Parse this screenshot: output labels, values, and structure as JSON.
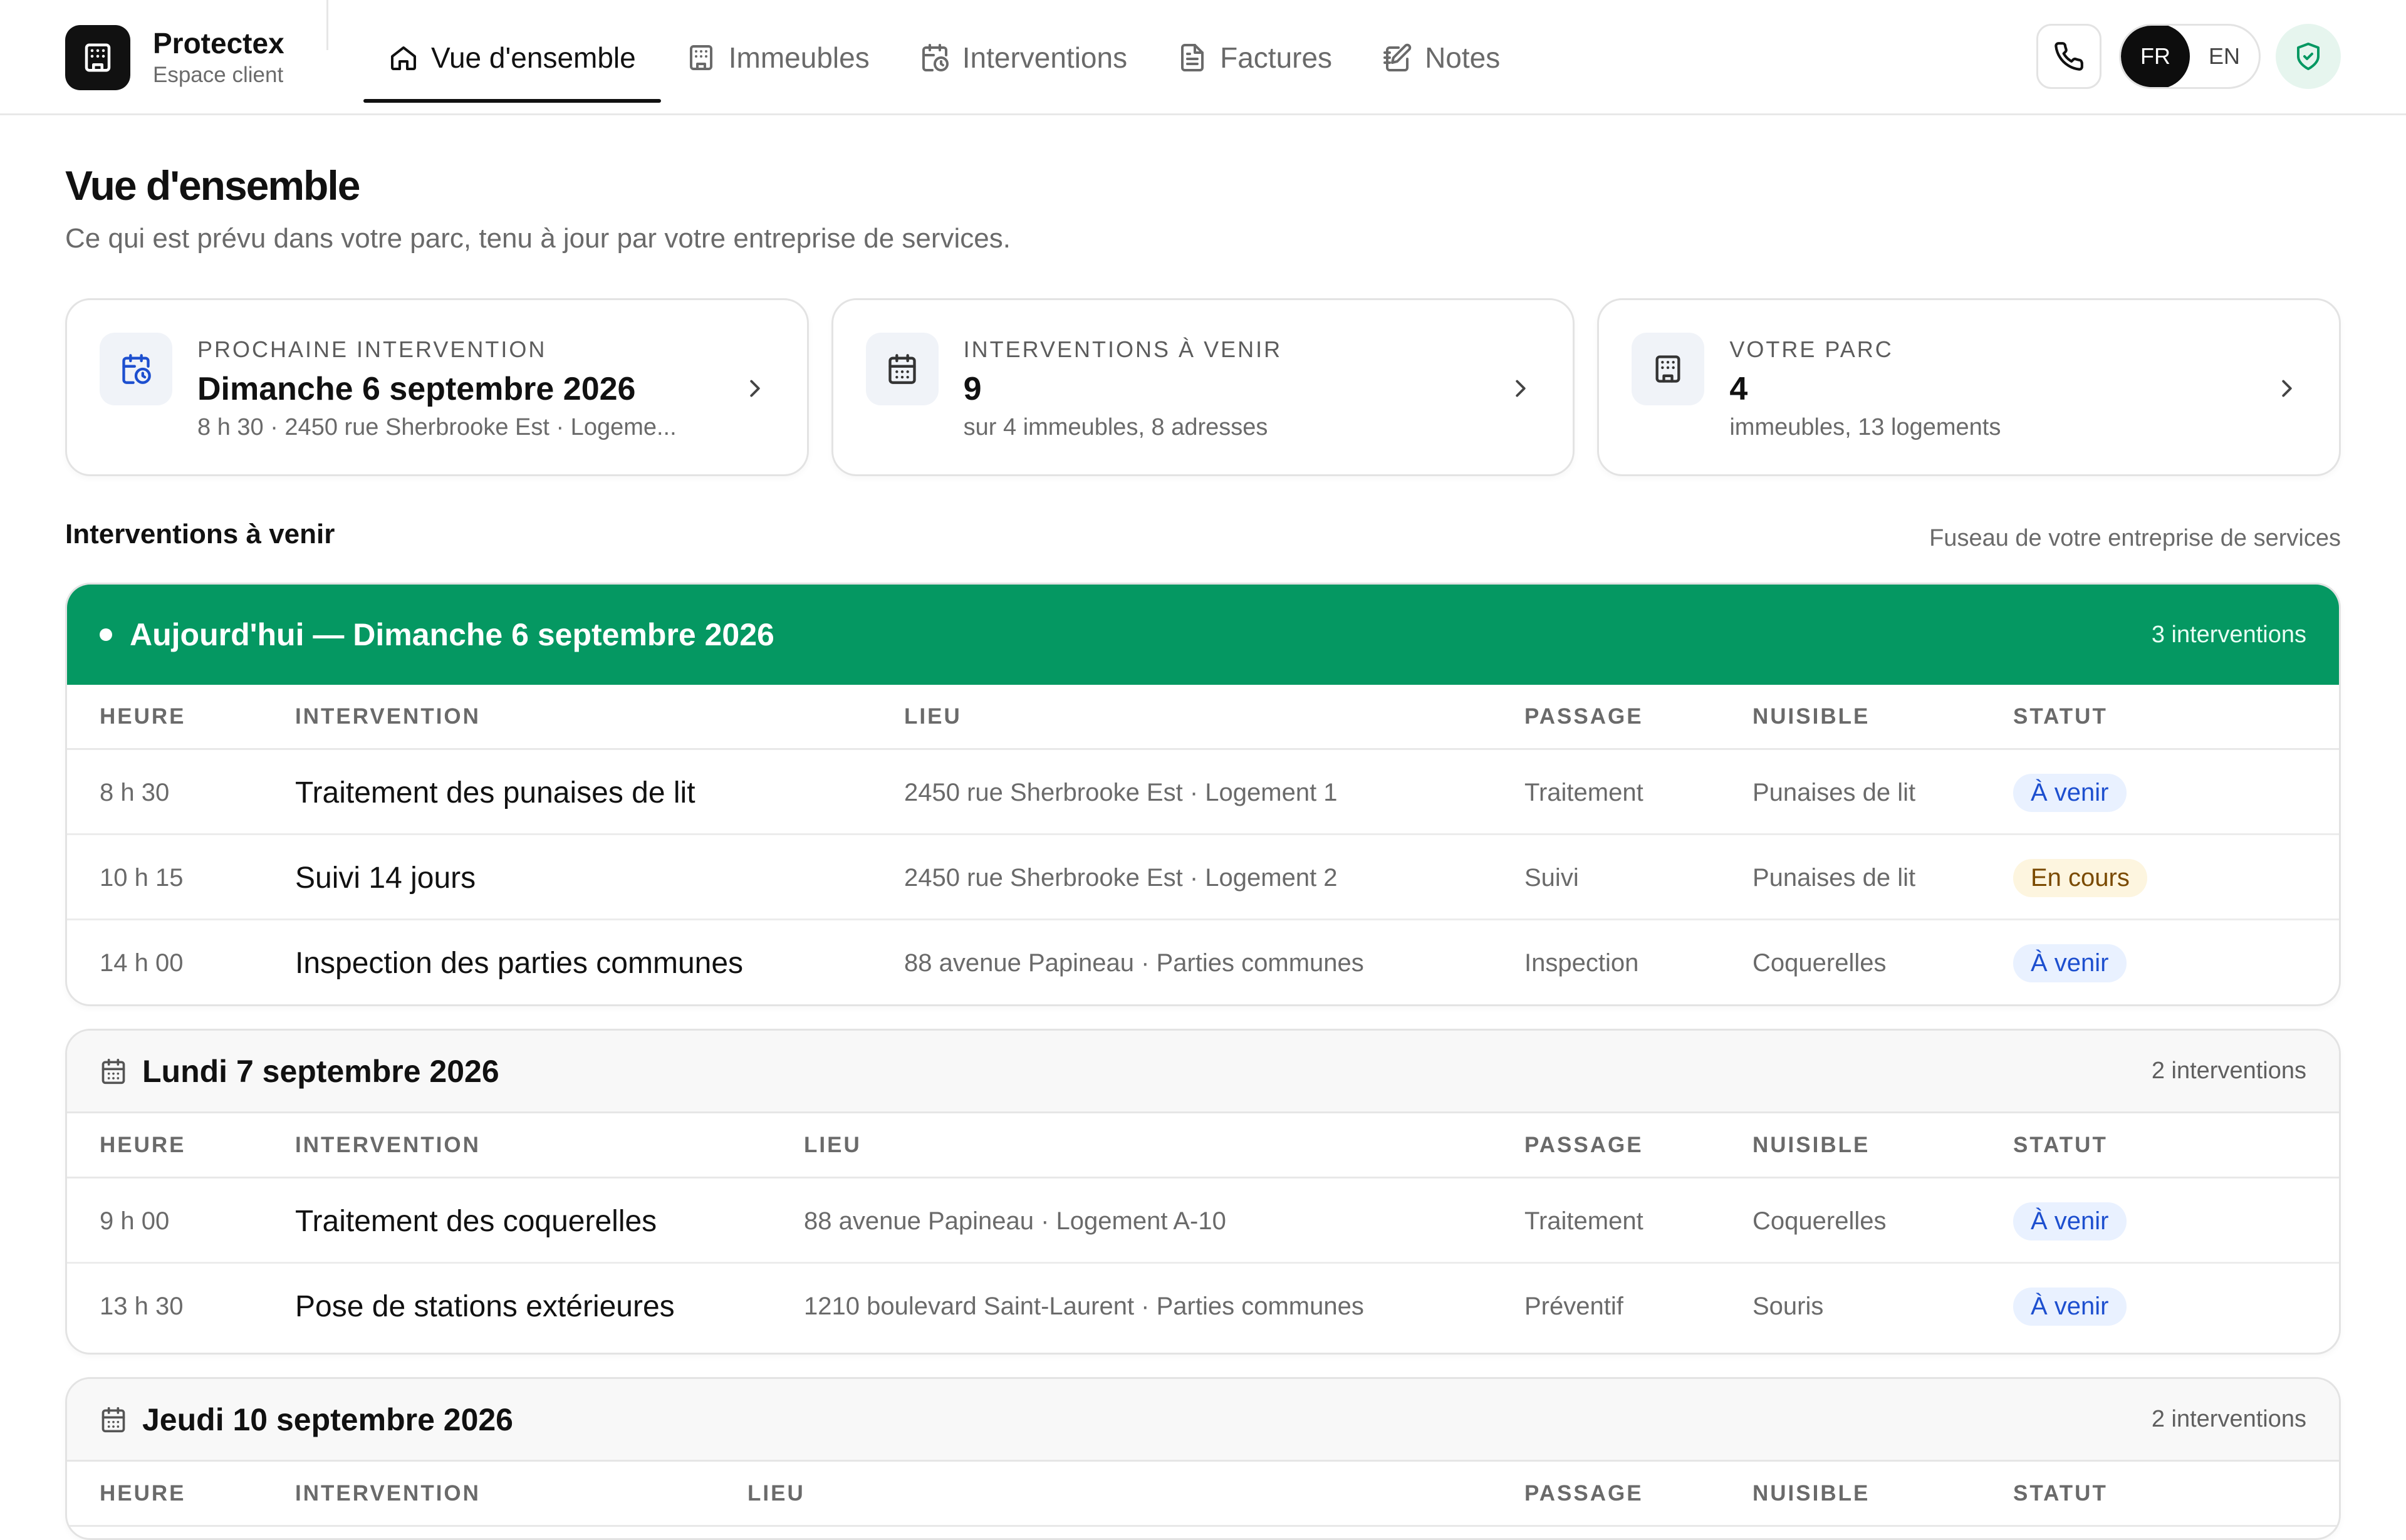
{
  "brand": {
    "name": "Protectex",
    "subtitle": "Espace client"
  },
  "nav": [
    {
      "label": "Vue d'ensemble",
      "icon": "home-icon",
      "active": true
    },
    {
      "label": "Immeubles",
      "icon": "building-icon"
    },
    {
      "label": "Interventions",
      "icon": "calendar-clock-icon"
    },
    {
      "label": "Factures",
      "icon": "file-icon"
    },
    {
      "label": "Notes",
      "icon": "notebook-icon"
    }
  ],
  "lang": {
    "fr": "FR",
    "en": "EN",
    "selected": "FR"
  },
  "page": {
    "title": "Vue d'ensemble",
    "subtitle": "Ce qui est prévu dans votre parc, tenu à jour par votre entreprise de services."
  },
  "cards": [
    {
      "label": "PROCHAINE INTERVENTION",
      "value": "Dimanche 6 septembre 2026",
      "detail": "8 h 30 · 2450 rue Sherbrooke Est · Logeme...",
      "icon": "calendar-clock-icon"
    },
    {
      "label": "INTERVENTIONS À VENIR",
      "value": "9",
      "detail": "sur 4 immeubles, 8 adresses",
      "icon": "calendar-icon"
    },
    {
      "label": "VOTRE PARC",
      "value": "4",
      "detail": "immeubles, 13 logements",
      "icon": "building-icon"
    }
  ],
  "section": {
    "title": "Interventions à venir",
    "note": "Fuseau de votre entreprise de services"
  },
  "columns": {
    "heure": "HEURE",
    "intervention": "INTERVENTION",
    "lieu": "LIEU",
    "passage": "PASSAGE",
    "nuisible": "NUISIBLE",
    "statut": "STATUT"
  },
  "days": [
    {
      "title": "Aujourd'hui — Dimanche 6 septembre 2026",
      "count": "3 interventions",
      "rows": [
        {
          "time": "8 h 30",
          "name": "Traitement des punaises de lit",
          "place": "2450 rue Sherbrooke Est · Logement 1",
          "passage": "Traitement",
          "pest": "Punaises de lit",
          "status": "À venir"
        },
        {
          "time": "10 h 15",
          "name": "Suivi 14 jours",
          "place": "2450 rue Sherbrooke Est · Logement 2",
          "passage": "Suivi",
          "pest": "Punaises de lit",
          "status": "En cours"
        },
        {
          "time": "14 h 00",
          "name": "Inspection des parties communes",
          "place": "88 avenue Papineau · Parties communes",
          "passage": "Inspection",
          "pest": "Coquerelles",
          "status": "À venir"
        }
      ]
    },
    {
      "title": "Lundi 7 septembre 2026",
      "count": "2 interventions",
      "rows": [
        {
          "time": "9 h 00",
          "name": "Traitement des coquerelles",
          "place": "88 avenue Papineau · Logement A-10",
          "passage": "Traitement",
          "pest": "Coquerelles",
          "status": "À venir"
        },
        {
          "time": "13 h 30",
          "name": "Pose de stations extérieures",
          "place": "1210 boulevard Saint-Laurent · Parties communes",
          "passage": "Préventif",
          "pest": "Souris",
          "status": "À venir"
        }
      ]
    },
    {
      "title": "Jeudi 10 septembre 2026",
      "count": "2 interventions",
      "rows": []
    }
  ],
  "colors": {
    "today": "#059862",
    "upcoming_badge": "#e9f1ff",
    "in_progress_badge": "#fdf5df"
  }
}
